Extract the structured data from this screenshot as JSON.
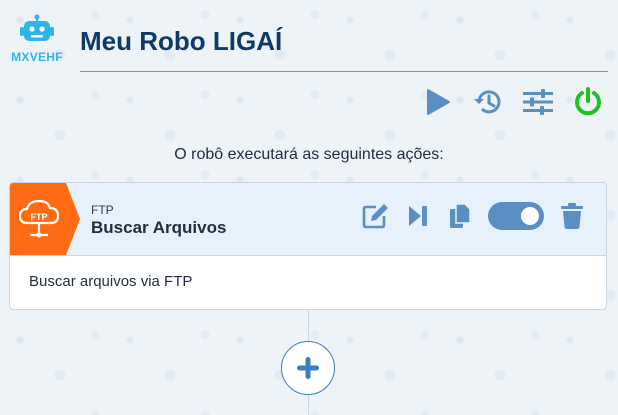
{
  "robot": {
    "code": "MXVEHF",
    "title": "Meu Robo LIGAÍ"
  },
  "toolbar": {
    "buttons": [
      {
        "icon": "play-icon",
        "color": "#5b8fc3"
      },
      {
        "icon": "history-icon",
        "color": "#5b8fc3"
      },
      {
        "icon": "settings-sliders-icon",
        "color": "#5b8fc3"
      },
      {
        "icon": "power-icon",
        "color": "#1ec21e"
      }
    ]
  },
  "main": {
    "subtitle": "O robô executará as seguintes ações:",
    "actions": [
      {
        "badge_label": "FTP",
        "badge_color": "#ff6a13",
        "type": "FTP",
        "name": "Buscar Arquivos",
        "description": "Buscar arquivos via FTP",
        "enabled": true
      }
    ]
  },
  "colors": {
    "accent": "#2fb6e8",
    "icon": "#5b8fc3",
    "title": "#0d3b66",
    "power": "#1ec21e"
  }
}
